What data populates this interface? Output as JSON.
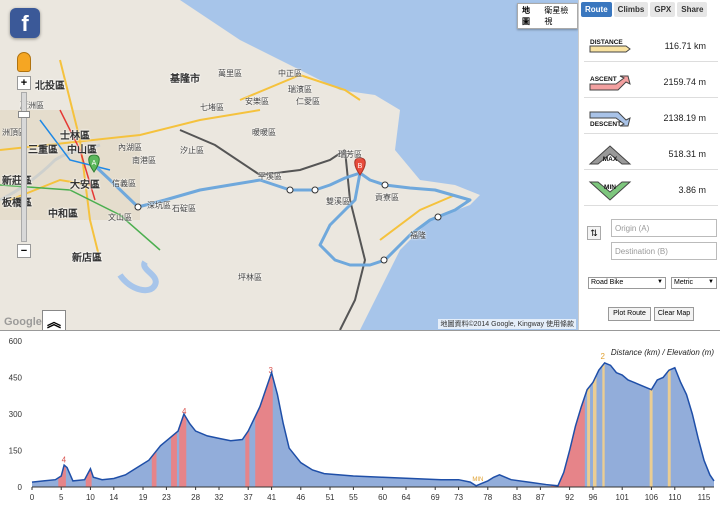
{
  "map": {
    "facebook_label": "f",
    "maptype": [
      "地圖",
      "衛星檢視"
    ],
    "google_logo": "Google",
    "attribution": "地圖資料©2014 Google, Kingway  使用條款",
    "zoom_in": "+",
    "zoom_out": "−",
    "collapse": "︽",
    "markers": {
      "start": "A",
      "end": "B"
    },
    "labels": [
      "北投區",
      "士林區",
      "中山區",
      "大安區",
      "信義區",
      "南港區",
      "內湖區",
      "汐止區",
      "三重區",
      "新莊區",
      "板橋區",
      "中和區",
      "新店區",
      "文山區",
      "深坑區",
      "石碇區",
      "平溪區",
      "雙溪區",
      "瑞芳區",
      "貢寮區",
      "坪林區",
      "萬里區",
      "基隆市",
      "七堵區",
      "安樂區",
      "仁愛區",
      "中正區",
      "瑞濱區",
      "暖暖區",
      "福隆",
      "洲頂區",
      "蘆洲區"
    ]
  },
  "panel": {
    "tabs": [
      "Route",
      "Climbs",
      "GPX",
      "Share"
    ],
    "stats": [
      {
        "label": "DISTANCE",
        "value": "116.71 km"
      },
      {
        "label": "ASCENT",
        "value": "2159.74 m"
      },
      {
        "label": "DESCENT",
        "value": "2138.19 m"
      },
      {
        "label": "MAX",
        "value": "518.31 m"
      },
      {
        "label": "MIN",
        "value": "3.86 m"
      }
    ],
    "origin_placeholder": "Origin (A)",
    "destination_placeholder": "Destination (B)",
    "mode_select": "Road Bike",
    "unit_select": "Metric",
    "plot_button": "Plot Route",
    "clear_button": "Clear Map",
    "swap_icon": "⇅"
  },
  "colors": {
    "route": "#5aa0d8",
    "profile_fill": "#7f9fd4",
    "profile_line": "#1f4fa8",
    "climb_red": "#f08080",
    "climb_yellow": "#f5d08a",
    "accent": "#3a77bf"
  },
  "chart_data": {
    "type": "area",
    "title": "Distance (km) / Elevation (m)",
    "xlabel": "Distance (km)",
    "ylabel": "Elevation (m)",
    "xticks": [
      0,
      5,
      10,
      14,
      19,
      23,
      28,
      32,
      37,
      41,
      46,
      51,
      55,
      60,
      64,
      69,
      73,
      78,
      83,
      87,
      92,
      96,
      101,
      106,
      110,
      115
    ],
    "yticks": [
      0,
      150,
      300,
      450,
      600
    ],
    "xlim": [
      0,
      116.71
    ],
    "ylim": [
      0,
      600
    ],
    "grid": false,
    "x": [
      0,
      2,
      4,
      5,
      5.5,
      6,
      7,
      9,
      10,
      10.5,
      12,
      14,
      16,
      18,
      20,
      21,
      22,
      23,
      24,
      25,
      26,
      27,
      28,
      30,
      32,
      34,
      36,
      37,
      38,
      39,
      40,
      41,
      42,
      43,
      44,
      46,
      48,
      50,
      55,
      60,
      65,
      70,
      73,
      75,
      76,
      77,
      78,
      79,
      80,
      82,
      85,
      88,
      90,
      91,
      92,
      93,
      94,
      95,
      96,
      97,
      98,
      99,
      100,
      101,
      102,
      104,
      106,
      107,
      108,
      109,
      110,
      111,
      112,
      113,
      114,
      115,
      116,
      116.71
    ],
    "y": [
      20,
      25,
      30,
      45,
      90,
      80,
      25,
      30,
      75,
      40,
      30,
      35,
      50,
      80,
      110,
      140,
      170,
      190,
      210,
      230,
      300,
      260,
      230,
      210,
      200,
      190,
      195,
      230,
      280,
      330,
      400,
      470,
      380,
      260,
      160,
      100,
      70,
      55,
      45,
      40,
      35,
      30,
      30,
      20,
      5,
      15,
      25,
      40,
      50,
      30,
      20,
      10,
      5,
      60,
      150,
      250,
      330,
      400,
      430,
      480,
      510,
      500,
      470,
      460,
      440,
      420,
      400,
      440,
      450,
      480,
      490,
      430,
      380,
      300,
      200,
      110,
      50,
      25
    ],
    "climbs": [
      {
        "start": 4.5,
        "end": 5.8,
        "category": "4"
      },
      {
        "start": 9.2,
        "end": 10.2,
        "category": ""
      },
      {
        "start": 20.5,
        "end": 21.3,
        "category": ""
      },
      {
        "start": 23.8,
        "end": 24.8,
        "category": ""
      },
      {
        "start": 25.2,
        "end": 26.4,
        "category": "4"
      },
      {
        "start": 36.5,
        "end": 37.2,
        "category": ""
      },
      {
        "start": 38.2,
        "end": 41.2,
        "category": "3"
      },
      {
        "start": 88.8,
        "end": 94.6,
        "category": ""
      },
      {
        "start": 95.0,
        "end": 95.5,
        "category": ""
      },
      {
        "start": 96.0,
        "end": 96.6,
        "category": ""
      },
      {
        "start": 97.6,
        "end": 98.0,
        "category": "2"
      },
      {
        "start": 105.7,
        "end": 106.2,
        "category": ""
      },
      {
        "start": 108.8,
        "end": 109.3,
        "category": ""
      }
    ],
    "min_label": {
      "x": 76.3,
      "text": "MIN"
    },
    "max_label": {
      "x": 97.8,
      "text": "MAX"
    }
  }
}
